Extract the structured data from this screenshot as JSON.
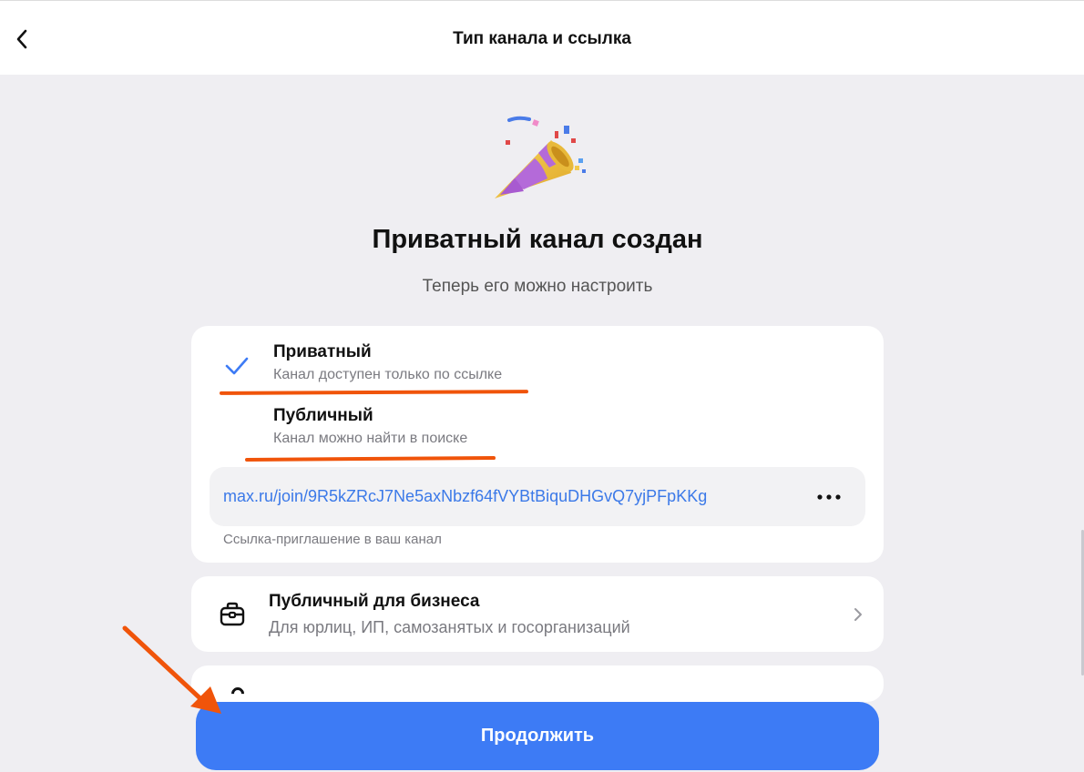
{
  "header": {
    "title": "Тип канала и ссылка",
    "back_icon": "chevron-left-icon"
  },
  "hero": {
    "icon": "party-popper-icon",
    "title": "Приватный канал создан",
    "subtitle": "Теперь его можно настроить"
  },
  "channel_type": {
    "options": [
      {
        "title": "Приватный",
        "description": "Канал доступен только по ссылке",
        "selected": true
      },
      {
        "title": "Публичный",
        "description": "Канал можно найти в поиске",
        "selected": false
      }
    ],
    "invite_link": "max.ru/join/9R5kZRcJ7Ne5axNbzf64fVYBtBiquDHGvQ7yjPFpKKg",
    "invite_caption": "Ссылка-приглашение в ваш канал",
    "more_icon": "more-horizontal-icon"
  },
  "business": {
    "icon": "briefcase-icon",
    "title": "Публичный для бизнеса",
    "description": "Для юрлиц, ИП, самозанятых и госорганизаций"
  },
  "footer": {
    "continue_label": "Продолжить"
  },
  "colors": {
    "accent": "#3d7bf5",
    "link": "#3b79e8",
    "annotation": "#f0540a",
    "background": "#efeef2"
  }
}
